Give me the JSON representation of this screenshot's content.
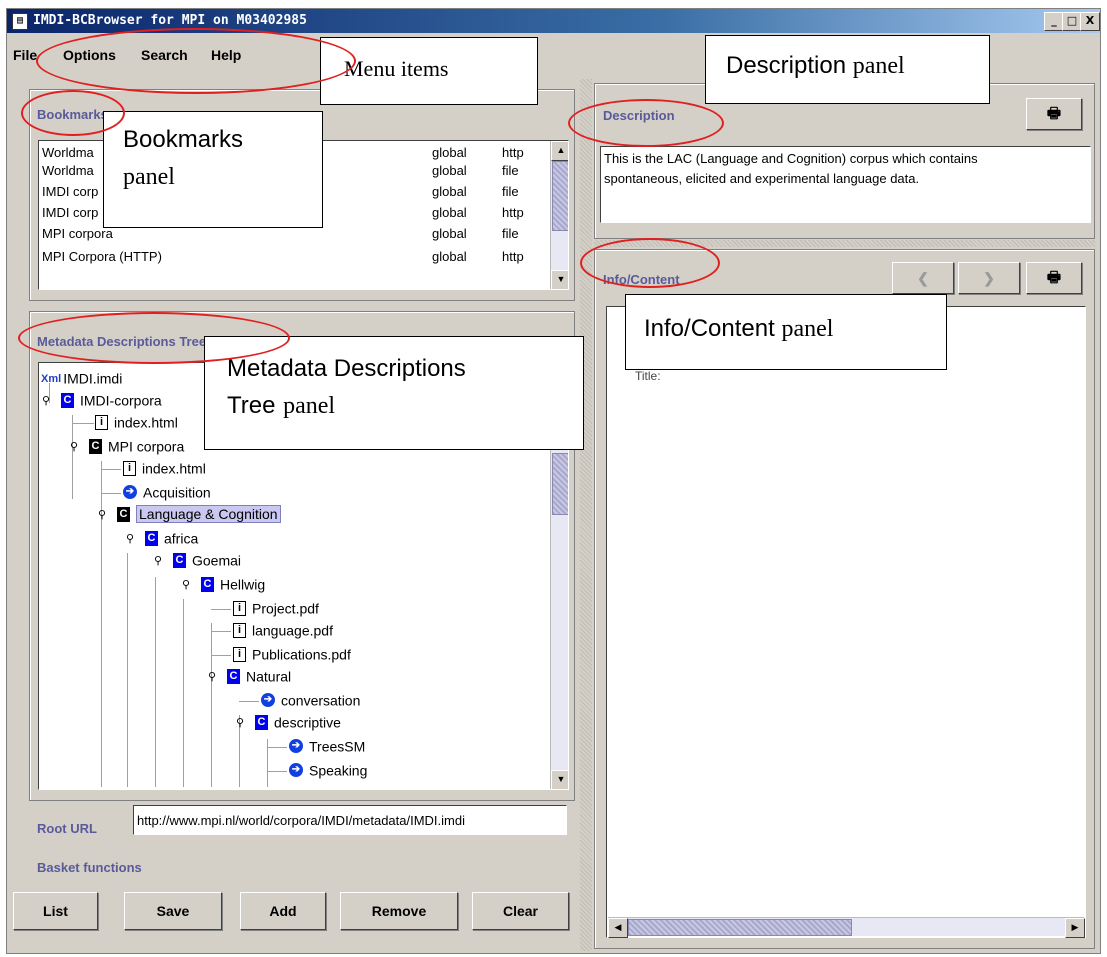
{
  "window": {
    "title": "IMDI-BCBrowser for MPI on M03402985",
    "minimize": "_",
    "maximize": "□",
    "close": "X"
  },
  "menu": {
    "items": [
      "File",
      "Options",
      "Search",
      "Help"
    ]
  },
  "bookmarks": {
    "title": "Bookmarks",
    "rows": [
      {
        "name": "Worldma",
        "scope": "global",
        "protocol": "http"
      },
      {
        "name": "Worldma",
        "scope": "global",
        "protocol": "file"
      },
      {
        "name": "IMDI corp",
        "scope": "global",
        "protocol": "file"
      },
      {
        "name": "IMDI corp",
        "scope": "global",
        "protocol": "http"
      },
      {
        "name": "MPI corpora",
        "scope": "global",
        "protocol": "file"
      },
      {
        "name": "MPI Corpora (HTTP)",
        "scope": "global",
        "protocol": "http"
      }
    ]
  },
  "tree": {
    "title": "Metadata Descriptions Tree",
    "root": "IMDI.imdi",
    "root_icon": "Xml",
    "nodes": [
      {
        "label": "IMDI-corpora",
        "icon": "C",
        "kind": "corpus",
        "toggle": "o"
      },
      {
        "label": "index.html",
        "icon": "i",
        "kind": "info"
      },
      {
        "label": "MPI corpora",
        "icon": "C",
        "kind": "corpus-black",
        "toggle": "o"
      },
      {
        "label": "index.html",
        "icon": "i",
        "kind": "info"
      },
      {
        "label": "Acquisition",
        "icon": "→",
        "kind": "session"
      },
      {
        "label": "Language & Cognition",
        "icon": "C",
        "kind": "corpus-black",
        "toggle": "o",
        "selected": true
      },
      {
        "label": "africa",
        "icon": "C",
        "kind": "corpus",
        "toggle": "o"
      },
      {
        "label": "Goemai",
        "icon": "C",
        "kind": "corpus",
        "toggle": "o"
      },
      {
        "label": "Hellwig",
        "icon": "C",
        "kind": "corpus",
        "toggle": "o"
      },
      {
        "label": "Project.pdf",
        "icon": "i",
        "kind": "info"
      },
      {
        "label": "language.pdf",
        "icon": "i",
        "kind": "info"
      },
      {
        "label": "Publications.pdf",
        "icon": "i",
        "kind": "info"
      },
      {
        "label": "Natural",
        "icon": "C",
        "kind": "corpus",
        "toggle": "o"
      },
      {
        "label": "conversation",
        "icon": "→",
        "kind": "session"
      },
      {
        "label": "descriptive",
        "icon": "C",
        "kind": "corpus",
        "toggle": "o"
      },
      {
        "label": "TreesSM",
        "icon": "→",
        "kind": "session"
      },
      {
        "label": "Speaking",
        "icon": "→",
        "kind": "session"
      }
    ]
  },
  "root_url": {
    "label": "Root URL",
    "value": "http://www.mpi.nl/world/corpora/IMDI/metadata/IMDI.imdi"
  },
  "basket": {
    "label": "Basket functions",
    "buttons": [
      "List",
      "Save",
      "Add",
      "Remove",
      "Clear"
    ]
  },
  "description": {
    "title": "Description",
    "text_line1": "This is the LAC (Language and Cognition) corpus which contains",
    "text_line2": "spontaneous, elicited and experimental language data.",
    "print_icon": "printer-icon"
  },
  "info": {
    "title": "Info/Content",
    "back_icon": "arrow-left-icon",
    "forward_icon": "arrow-right-icon",
    "print_icon": "printer-icon",
    "content_fragment": "Title:"
  },
  "annotations": {
    "menu": "Menu items",
    "description_a": "Description",
    "description_b": "panel",
    "bookmarks_a": "Bookmarks",
    "bookmarks_b": "panel",
    "tree_a": "Metadata Descriptions",
    "tree_b1": "Tree",
    "tree_b2": "panel",
    "info_a": "Info/Content",
    "info_b": "panel"
  },
  "colors": {
    "accent": "#5a5a9a",
    "annotation_ring": "#e02020",
    "titlebar": "#0a246a",
    "corpus_icon": "#0000ee"
  }
}
